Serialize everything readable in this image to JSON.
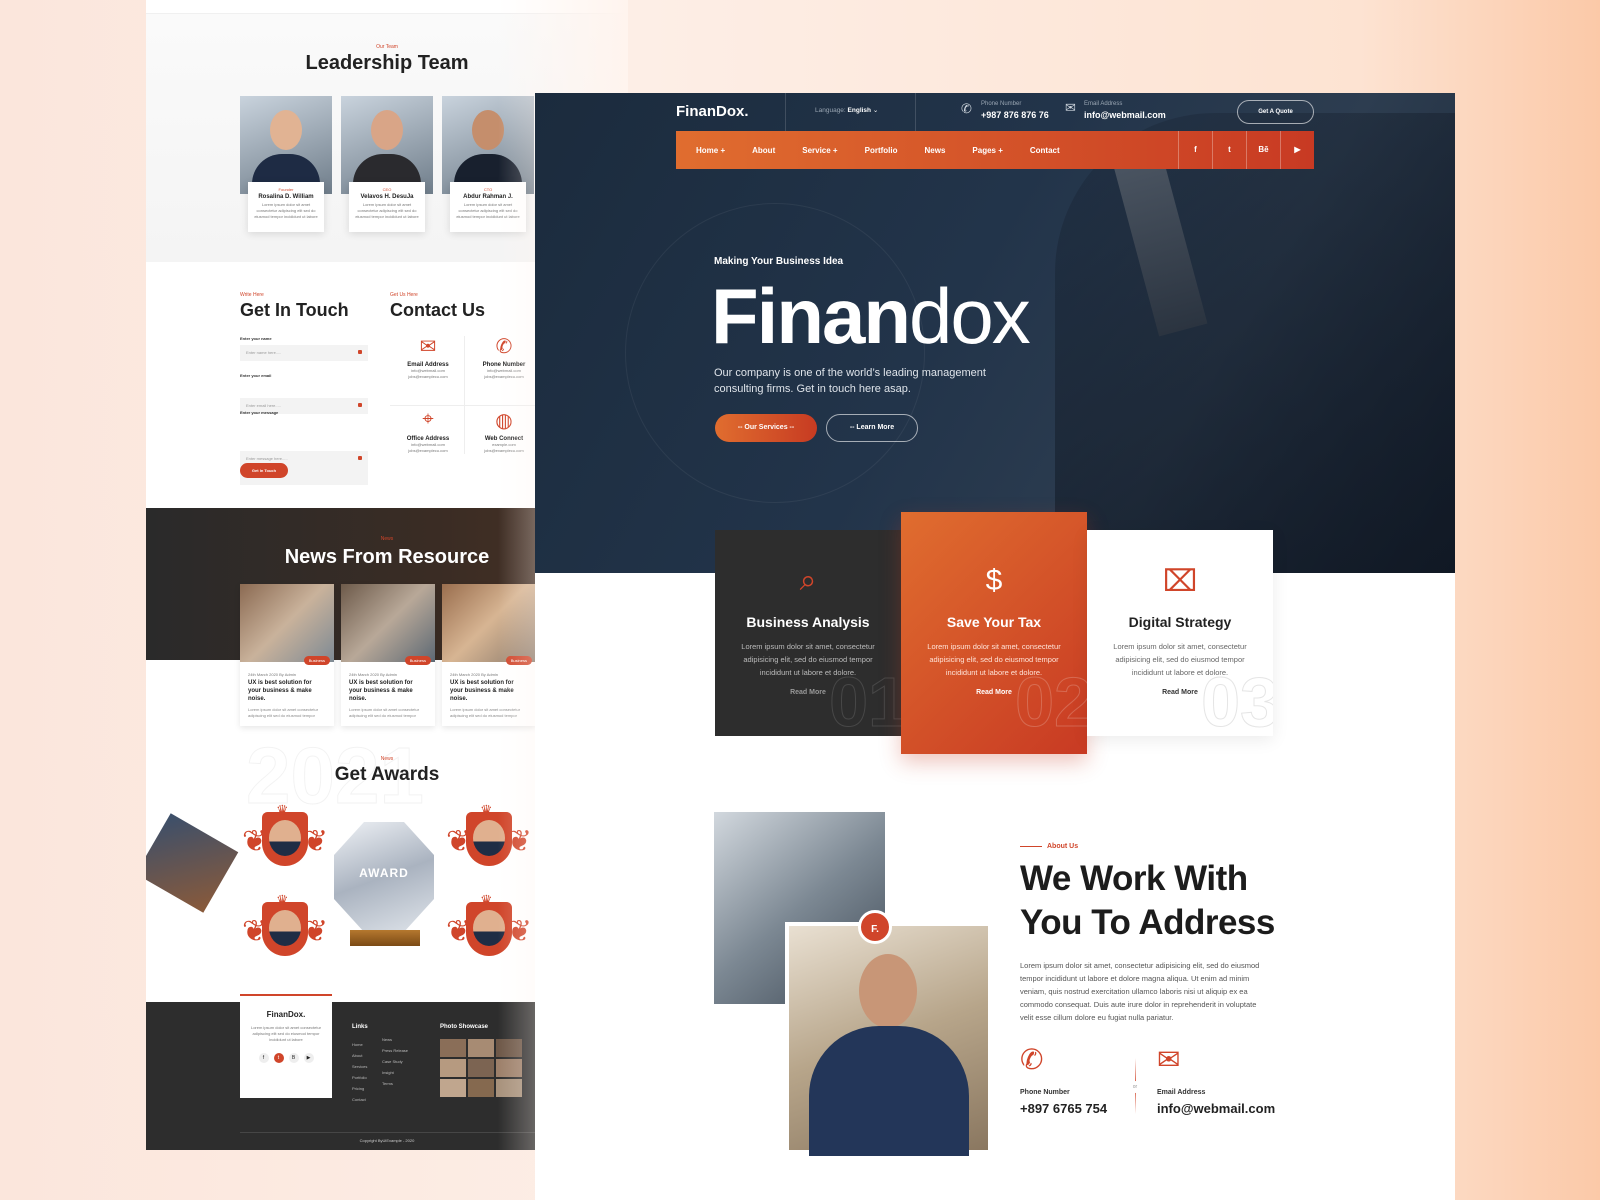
{
  "left": {
    "team": {
      "eyebrow": "Our Team",
      "title": "Leadership Team",
      "members": [
        {
          "role": "Founder",
          "name": "Rosalina D. William",
          "text": "Lorem ipsum dolor sit amet consectetur adipiscing elit sed do eiusmod tempor incididunt ut labore"
        },
        {
          "role": "CEO",
          "name": "Velavos H. DesuJa",
          "text": "Lorem ipsum dolor sit amet consectetur adipiscing elit sed do eiusmod tempor incididunt ut labore"
        },
        {
          "role": "CTO",
          "name": "Abdur Rahman J.",
          "text": "Lorem ipsum dolor sit amet consectetur adipiscing elit sed do eiusmod tempor incididunt ut labore"
        }
      ]
    },
    "touch": {
      "eyebrow": "Write Here",
      "title": "Get In Touch",
      "name_label": "Enter your name",
      "name_placeholder": "Enter name here.....",
      "email_label": "Enter your email",
      "email_placeholder": "Enter email here.....",
      "message_label": "Enter your message",
      "message_placeholder": "Enter message here.....",
      "button": "Get In Touch"
    },
    "contact": {
      "eyebrow": "Get Us Here",
      "title": "Contact Us",
      "boxes": [
        {
          "title": "Email Address",
          "l1": "info@webmail.com",
          "l2": "jobs@examplecu.com"
        },
        {
          "title": "Phone Number",
          "l1": "info@webmail.com",
          "l2": "jobs@examplecu.com"
        },
        {
          "title": "Office Address",
          "l1": "info@webmail.com",
          "l2": "jobs@examplecu.com"
        },
        {
          "title": "Web Connect",
          "l1": "example.com",
          "l2": "jobs@examplecu.com"
        }
      ]
    },
    "news": {
      "eyebrow": "News",
      "title": "News From Resource",
      "cards": [
        {
          "tag": "Business",
          "meta": "24th March 2020   By Admin",
          "title": "UX is best solution for your business & make noise.",
          "text": "Lorem ipsum dolor sit amet consectetur adipiscing elit sed do eiusmod tempor"
        },
        {
          "tag": "Business",
          "meta": "24th March 2020   By Admin",
          "title": "UX is best solution for your business & make noise.",
          "text": "Lorem ipsum dolor sit amet consectetur adipiscing elit sed do eiusmod tempor"
        },
        {
          "tag": "Business",
          "meta": "24th March 2020   By Admin",
          "title": "UX is best solution for your business & make noise.",
          "text": "Lorem ipsum dolor sit amet consectetur adipiscing elit sed do eiusmod tempor"
        }
      ]
    },
    "awards": {
      "eyebrow": "News",
      "title": "Get Awards",
      "bg_year": "2021",
      "trophy_label": "AWARD"
    },
    "footer": {
      "brand": "FinanDox.",
      "about": "Lorem ipsum dolor sit amet consectetur adipiscing elit sed do eiusmod tempor incididunt ut labore",
      "links_title": "Links",
      "links_col1": [
        "Home",
        "About",
        "Services",
        "Portfolio",
        "Pricing",
        "Contact"
      ],
      "links_col2": [
        "News",
        "Press Release",
        "Case Study",
        "Insight",
        "Terms"
      ],
      "photo_title": "Photo Showcase",
      "copyright": "Copyright ByUiExample - 2020"
    }
  },
  "header": {
    "brand": "FinanDox.",
    "language_label": "Language:",
    "language_value": "English",
    "phone_label": "Phone Number",
    "phone_value": "+987 876 876 76",
    "email_label": "Email Address",
    "email_value": "info@webmail.com",
    "quote_button": "Get A Quote"
  },
  "nav": {
    "items": [
      "Home +",
      "About",
      "Service +",
      "Portfolio",
      "News",
      "Pages +",
      "Contact"
    ],
    "social": [
      "f",
      "t",
      "Bē",
      "▶"
    ]
  },
  "hero": {
    "eyebrow": "Making Your Business Idea",
    "title_bold": "Finan",
    "title_light": "dox",
    "text": "Our company is one of the world’s leading management consulting firms. Get in touch here asap.",
    "btn_primary": "--  Our Services  --",
    "btn_secondary": "--  Learn More"
  },
  "services": [
    {
      "title": "Business Analysis",
      "text": "Lorem ipsum dolor sit amet, consectetur adipisicing elit, sed do eiusmod tempor incididunt ut labore et dolore.",
      "more": "Read More",
      "num": "01"
    },
    {
      "title": "Save Your Tax",
      "text": "Lorem ipsum dolor sit amet, consectetur adipisicing elit, sed do eiusmod tempor incididunt ut labore et dolore.",
      "more": "Read More",
      "num": "02"
    },
    {
      "title": "Digital Strategy",
      "text": "Lorem ipsum dolor sit amet, consectetur adipisicing elit, sed do eiusmod tempor incididunt ut labore et dolore.",
      "more": "Read More",
      "num": "03"
    }
  ],
  "about": {
    "badge": "F.",
    "eyebrow": "About Us",
    "title1": "We Work With",
    "title2": "You To Address",
    "text": "Lorem ipsum dolor sit amet, consectetur adipisicing elit, sed do eiusmod tempor incididunt ut labore et dolore magna aliqua. Ut enim ad minim veniam, quis nostrud exercitation ullamco laboris nisi ut aliquip ex ea commodo consequat. Duis aute irure dolor in reprehenderit in voluptate velit esse cillum dolore eu fugiat nulla pariatur.",
    "phone_label": "Phone Number",
    "phone_value": "+897 6765 754",
    "or": "or",
    "email_label": "Email Address",
    "email_value": "info@webmail.com"
  },
  "colors": {
    "accent": "#d0452a",
    "accent_light": "#e06d2f",
    "navy": "#1b2b3d",
    "dark": "#2d2d2d"
  }
}
